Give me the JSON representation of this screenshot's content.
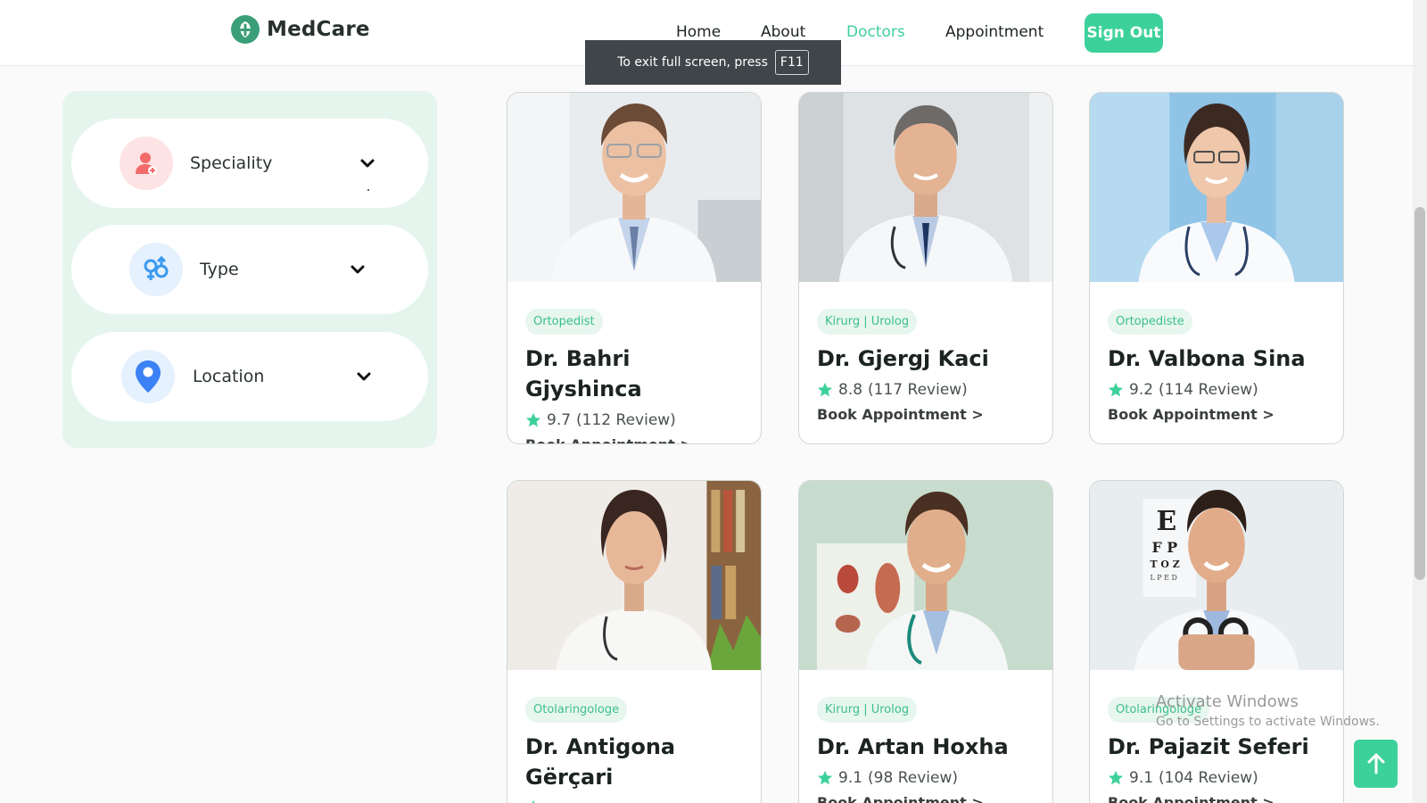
{
  "header": {
    "brand": "MedCare",
    "nav": [
      {
        "label": "Home",
        "active": false
      },
      {
        "label": "About",
        "active": false
      },
      {
        "label": "Doctors",
        "active": true
      },
      {
        "label": "Appointment",
        "active": false
      }
    ],
    "signout_label": "Sign Out"
  },
  "fullscreen_notice": {
    "text": "To exit full screen, press",
    "key": "F11"
  },
  "filters": [
    {
      "label": "Speciality",
      "icon": "doctor-icon",
      "color": "#f26b6b"
    },
    {
      "label": "Type",
      "icon": "gender-icon",
      "color": "#3b9af0"
    },
    {
      "label": "Location",
      "icon": "location-pin-icon",
      "color": "#3b82f6"
    }
  ],
  "doctors": [
    {
      "speciality": "Ortopedist",
      "name": "Dr. Bahri Gjyshinca",
      "rating": "9.7",
      "reviews": "(112 Review)",
      "book_label": "Book Appointment >"
    },
    {
      "speciality": "Kirurg | Urolog",
      "name": "Dr. Gjergj Kaci",
      "rating": "8.8",
      "reviews": "(117 Review)",
      "book_label": "Book Appointment >"
    },
    {
      "speciality": "Ortopediste",
      "name": "Dr. Valbona Sina",
      "rating": "9.2",
      "reviews": "(114 Review)",
      "book_label": "Book Appointment >"
    },
    {
      "speciality": "Otolaringologe",
      "name": "Dr. Antigona Gërçari",
      "rating": "",
      "reviews": "",
      "book_label": ""
    },
    {
      "speciality": "Kirurg | Urolog",
      "name": "Dr. Artan Hoxha",
      "rating": "9.1",
      "reviews": "(98 Review)",
      "book_label": "Book Appointment >"
    },
    {
      "speciality": "Otolaringologe",
      "name": "Dr. Pajazit Seferi",
      "rating": "9.1",
      "reviews": "(104 Review)",
      "book_label": "Book Appointment >"
    }
  ],
  "watermark": {
    "line1": "Activate Windows",
    "line2": "Go to Settings to activate Windows."
  },
  "colors": {
    "accent": "#3cd19b",
    "panel": "#e5f5ee",
    "badge_bg": "#e7f6ef"
  }
}
